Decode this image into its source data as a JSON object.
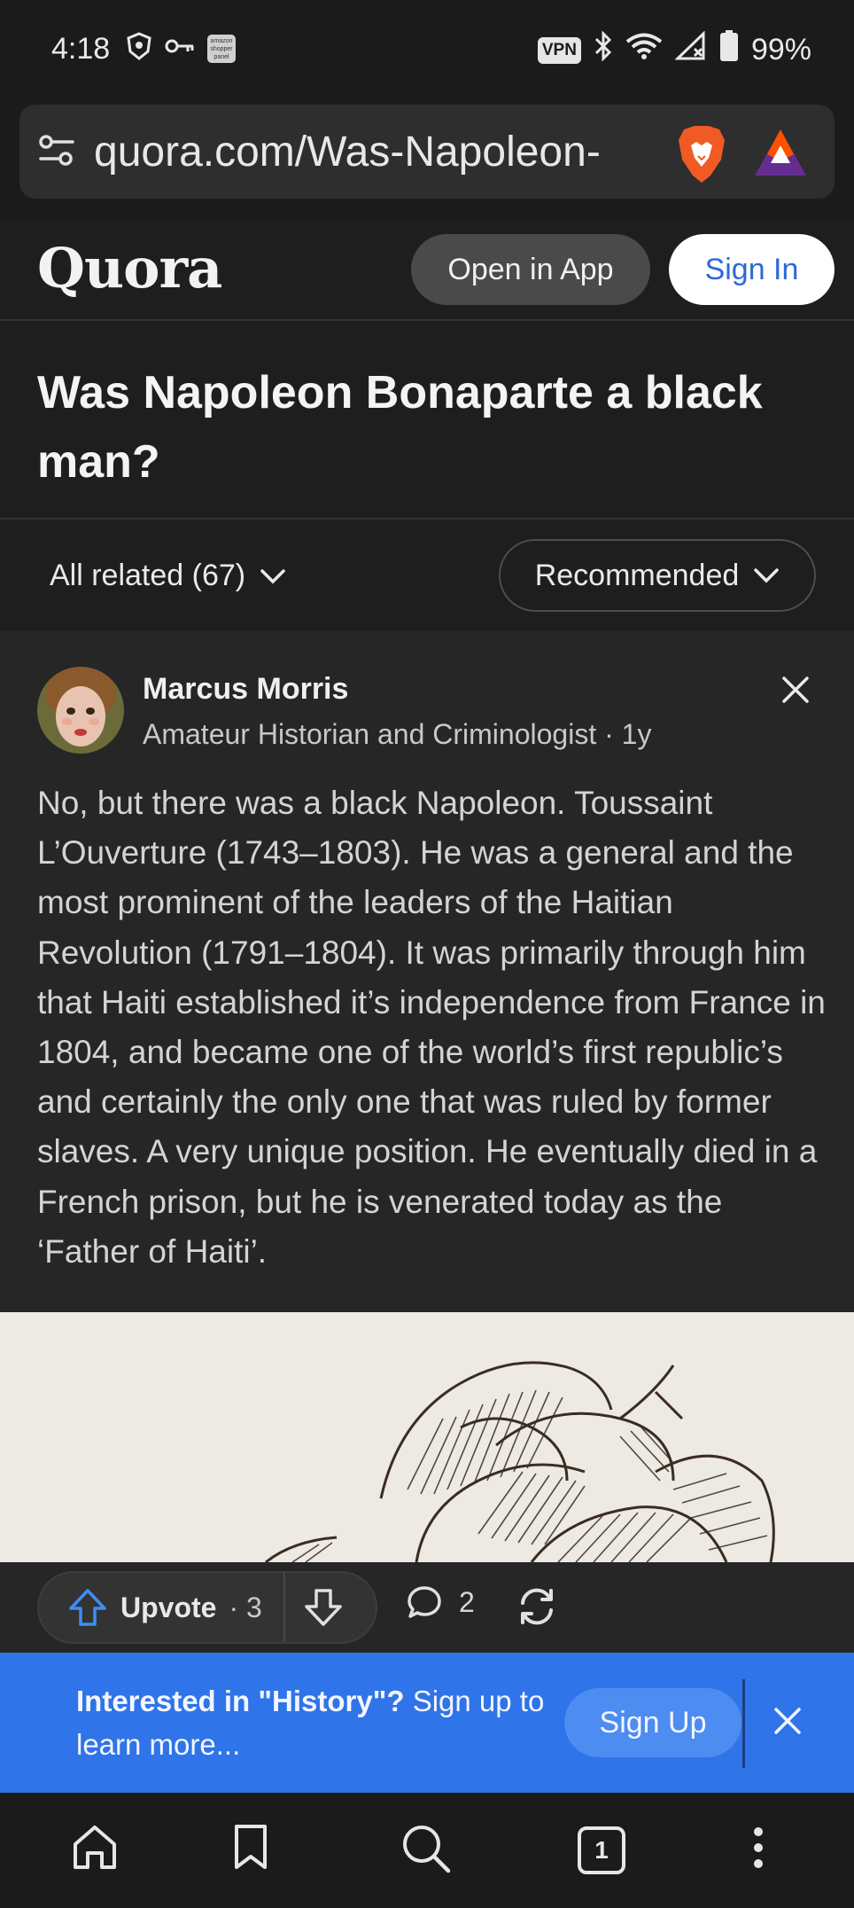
{
  "status_bar": {
    "time": "4:18",
    "vpn_label": "VPN",
    "amazon_badge": "amazon shopper panel",
    "battery": "99%",
    "icons": [
      "brave-shield-icon",
      "key-icon",
      "amazon-shopper-icon",
      "bluetooth-icon",
      "wifi-icon",
      "no-signal-icon",
      "battery-icon"
    ]
  },
  "browser": {
    "url": "quora.com/Was-Napoleon-",
    "icons": [
      "site-settings-icon",
      "brave-lion-icon",
      "brave-rewards-icon"
    ]
  },
  "quora_header": {
    "logo": "Quora",
    "open_in_app": "Open in App",
    "sign_in": "Sign In"
  },
  "question": {
    "title": "Was Napoleon Bonaparte a black man?"
  },
  "filters": {
    "all_related": "All related (67)",
    "sort": "Recommended"
  },
  "answer": {
    "author_name": "Marcus Morris",
    "author_credential": "Amateur Historian and Criminologist · 1y",
    "text": "No, but there was a black Napoleon. Toussaint L’Ouverture (1743–1803). He was a general and the most prominent of the leaders of the Haitian Revolution (1791–1804). It was primarily through him that Haiti established it’s independence from France in 1804, and became one of the world’s first republic’s and certainly the only one that was ruled by former slaves. A very unique position. He eventually died in a French prison, but he is venerated today as the ‘Father of Haiti’.",
    "upvote_label": "Upvote",
    "upvote_count": "· 3",
    "comment_count": "2"
  },
  "signup_banner": {
    "bold_text": "Interested in \"History\"?",
    "text": " Sign up to learn more...",
    "button": "Sign Up"
  },
  "bottom_nav": {
    "tab_count": "1",
    "icons": [
      "home-icon",
      "bookmark-icon",
      "search-icon",
      "tabs-icon",
      "more-icon"
    ]
  },
  "colors": {
    "accent_blue": "#2f74e8",
    "sign_in_text": "#2e69d8",
    "background": "#1e1e1e",
    "card": "#262626"
  }
}
